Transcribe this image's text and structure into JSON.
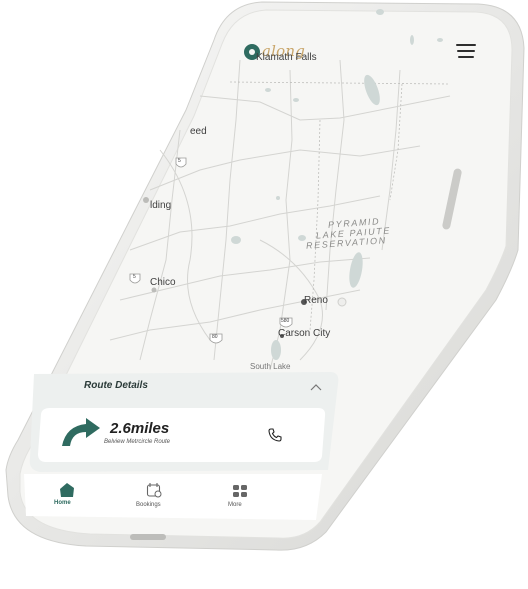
{
  "app": {
    "brand_name": "along",
    "brand_colors": {
      "primary": "#2f6b60",
      "accent": "#c9a66b"
    }
  },
  "map": {
    "header_city": "Klamath Falls",
    "labels": {
      "weed": "eed",
      "redding": "lding",
      "chico": "Chico",
      "reno": "Reno",
      "carson_city": "Carson City",
      "south_lake": "South Lake",
      "pyramid_line1": "PYRAMID",
      "pyramid_line2": "LAKE PAIUTE",
      "pyramid_line3": "RESERVATION"
    },
    "shields": {
      "i5_a": "5",
      "i5_b": "5",
      "i80": "80",
      "i580": "580"
    }
  },
  "route_details": {
    "title": "Route Details",
    "distance": "2.6miles",
    "route_name": "Belview Metrcircle Route",
    "toggle_icon": "chevron-up-icon",
    "call_icon": "phone-icon"
  },
  "nav": {
    "items": [
      {
        "label": "Home",
        "icon": "home-icon",
        "active": true
      },
      {
        "label": "Bookings",
        "icon": "calendar-icon",
        "active": false
      },
      {
        "label": "More",
        "icon": "grid-icon",
        "active": false
      }
    ]
  }
}
